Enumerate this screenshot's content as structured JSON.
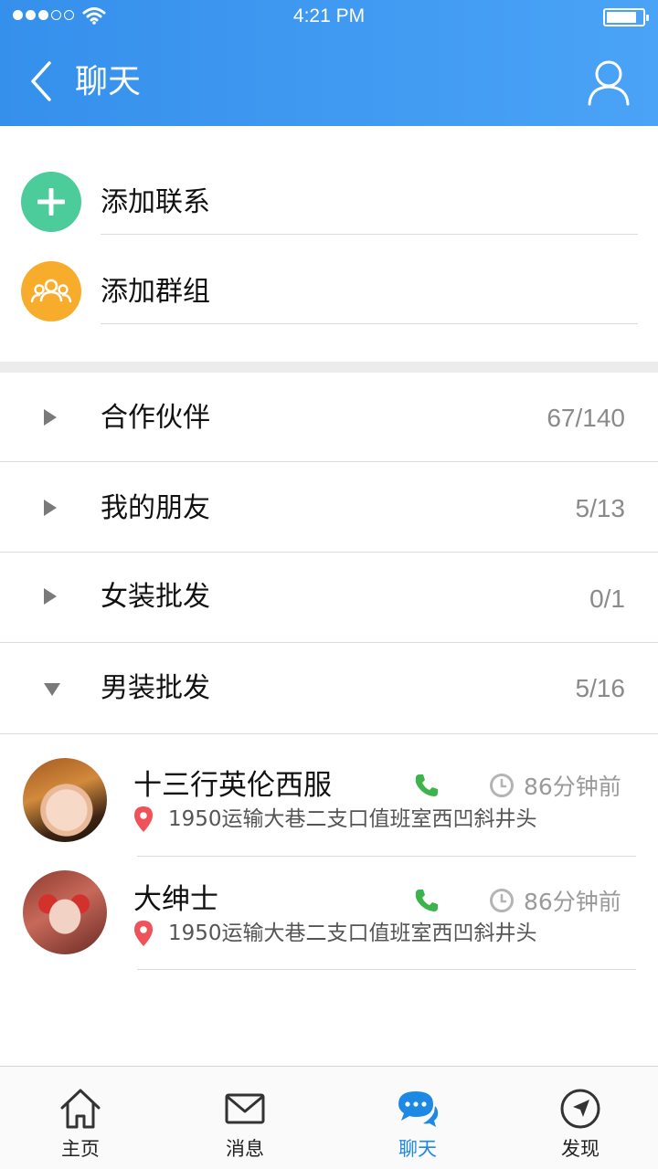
{
  "status_bar": {
    "time": "4:21 PM"
  },
  "header": {
    "title": "聊天"
  },
  "actions": [
    {
      "label": "添加联系",
      "icon": "add-contact-icon",
      "color": "#4ccb9b"
    },
    {
      "label": "添加群组",
      "icon": "add-group-icon",
      "color": "#f7ac2b"
    }
  ],
  "groups": [
    {
      "name": "合作伙伴",
      "count": "67/140",
      "expanded": false
    },
    {
      "name": "我的朋友",
      "count": "5/13",
      "expanded": false
    },
    {
      "name": "女装批发",
      "count": "0/1",
      "expanded": false
    },
    {
      "name": "男装批发",
      "count": "5/16",
      "expanded": true
    }
  ],
  "contacts": [
    {
      "name": "十三行英伦西服",
      "time": "86分钟前",
      "address": "1950运输大巷二支口值班室西凹斜井头"
    },
    {
      "name": "大绅士",
      "time": "86分钟前",
      "address": "1950运输大巷二支口值班室西凹斜井头"
    }
  ],
  "tabbar": {
    "items": [
      {
        "label": "主页",
        "icon": "home-icon"
      },
      {
        "label": "消息",
        "icon": "mail-icon"
      },
      {
        "label": "聊天",
        "icon": "chat-icon",
        "active": true
      },
      {
        "label": "发现",
        "icon": "compass-icon"
      }
    ]
  },
  "colors": {
    "accent": "#1e88e5",
    "header": "#3d99f0",
    "phone": "#3cb44b",
    "pin": "#f0525a"
  }
}
